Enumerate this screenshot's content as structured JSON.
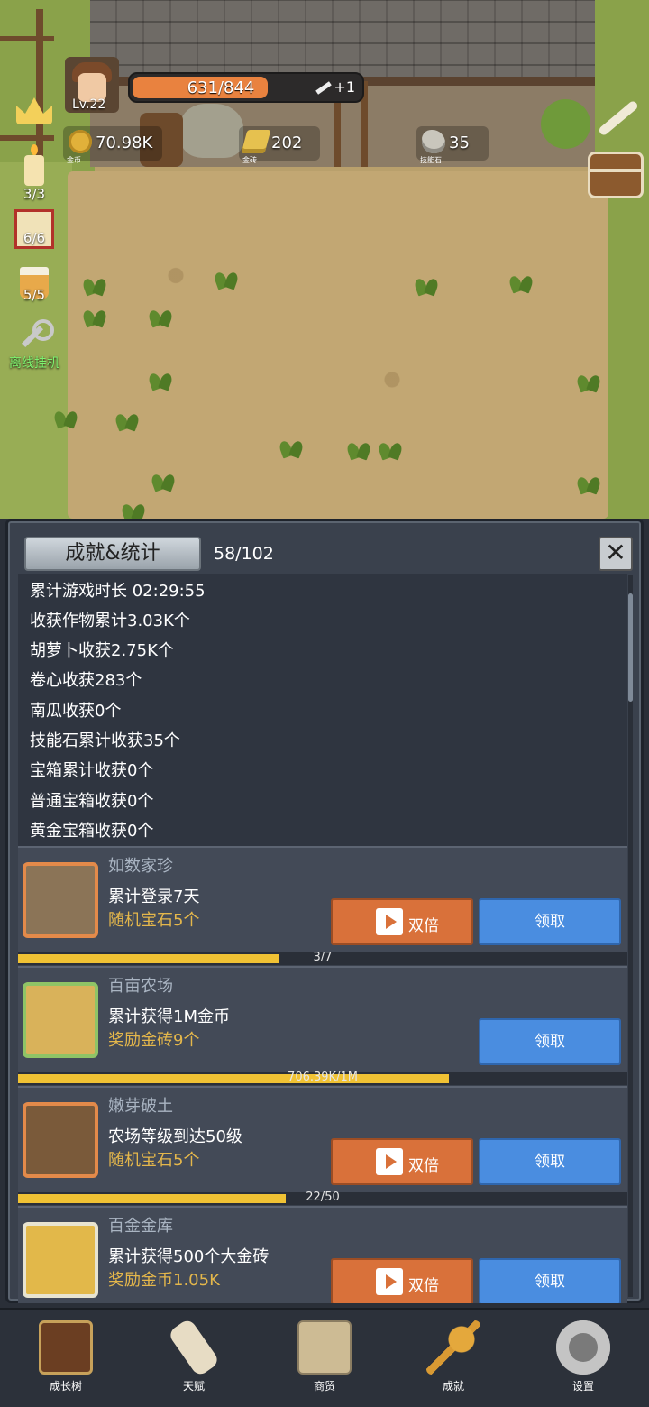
{
  "hud": {
    "level": "Lv.22",
    "hp": "631/844",
    "hp_fraction": 0.7476,
    "energy_bonus": "+1",
    "resources": [
      {
        "icon": "coin-icon",
        "value": "70.98K",
        "label": "金币"
      },
      {
        "icon": "gold-brick-icon",
        "value": "202",
        "label": "金砖"
      },
      {
        "icon": "skill-stone-icon",
        "value": "35",
        "label": "技能石"
      }
    ]
  },
  "side": {
    "candle_count": "3/3",
    "dice_count": "6/6",
    "cup_count": "5/5",
    "idle_label": "离线挂机"
  },
  "panel": {
    "title": "成就&统计",
    "progress": "58/102",
    "stats": [
      "累计游戏时长 02:29:55",
      "收获作物累计3.03K个",
      "胡萝卜收获2.75K个",
      "卷心收获283个",
      "南瓜收获0个",
      "技能石累计收获35个",
      "宝箱累计收获0个",
      "普通宝箱收获0个",
      "黄金宝箱收获0个"
    ],
    "achievements": [
      {
        "name": "如数家珍",
        "desc": "累计登录7天",
        "reward": "随机宝石5个",
        "double": "双倍",
        "claim": "领取",
        "progress": "3/7",
        "fraction": 0.4286
      },
      {
        "name": "百亩农场",
        "desc": "累计获得1M金币",
        "reward": "奖励金砖9个",
        "claim": "领取",
        "progress": "706.39K/1M",
        "fraction": 0.7064
      },
      {
        "name": "嫩芽破土",
        "desc": "农场等级到达50级",
        "reward": "随机宝石5个",
        "double": "双倍",
        "claim": "领取",
        "progress": "22/50",
        "fraction": 0.44
      },
      {
        "name": "百金金库",
        "desc": "累计获得500个大金砖",
        "reward": "奖励金币1.05K",
        "double": "双倍",
        "claim": "领取"
      }
    ]
  },
  "nav": [
    {
      "label": "成长树",
      "icon": "book-icon"
    },
    {
      "label": "天赋",
      "icon": "scroll-icon"
    },
    {
      "label": "商贸",
      "icon": "map-icon"
    },
    {
      "label": "成就",
      "icon": "key-icon"
    },
    {
      "label": "设置",
      "icon": "gear-icon"
    }
  ],
  "colors": {
    "hp_bar": "#e9823f",
    "double_button": "#d9713a",
    "claim_button": "#4a8de0",
    "progress_fill": "#f0c234",
    "reward_text": "#e4b74b"
  }
}
